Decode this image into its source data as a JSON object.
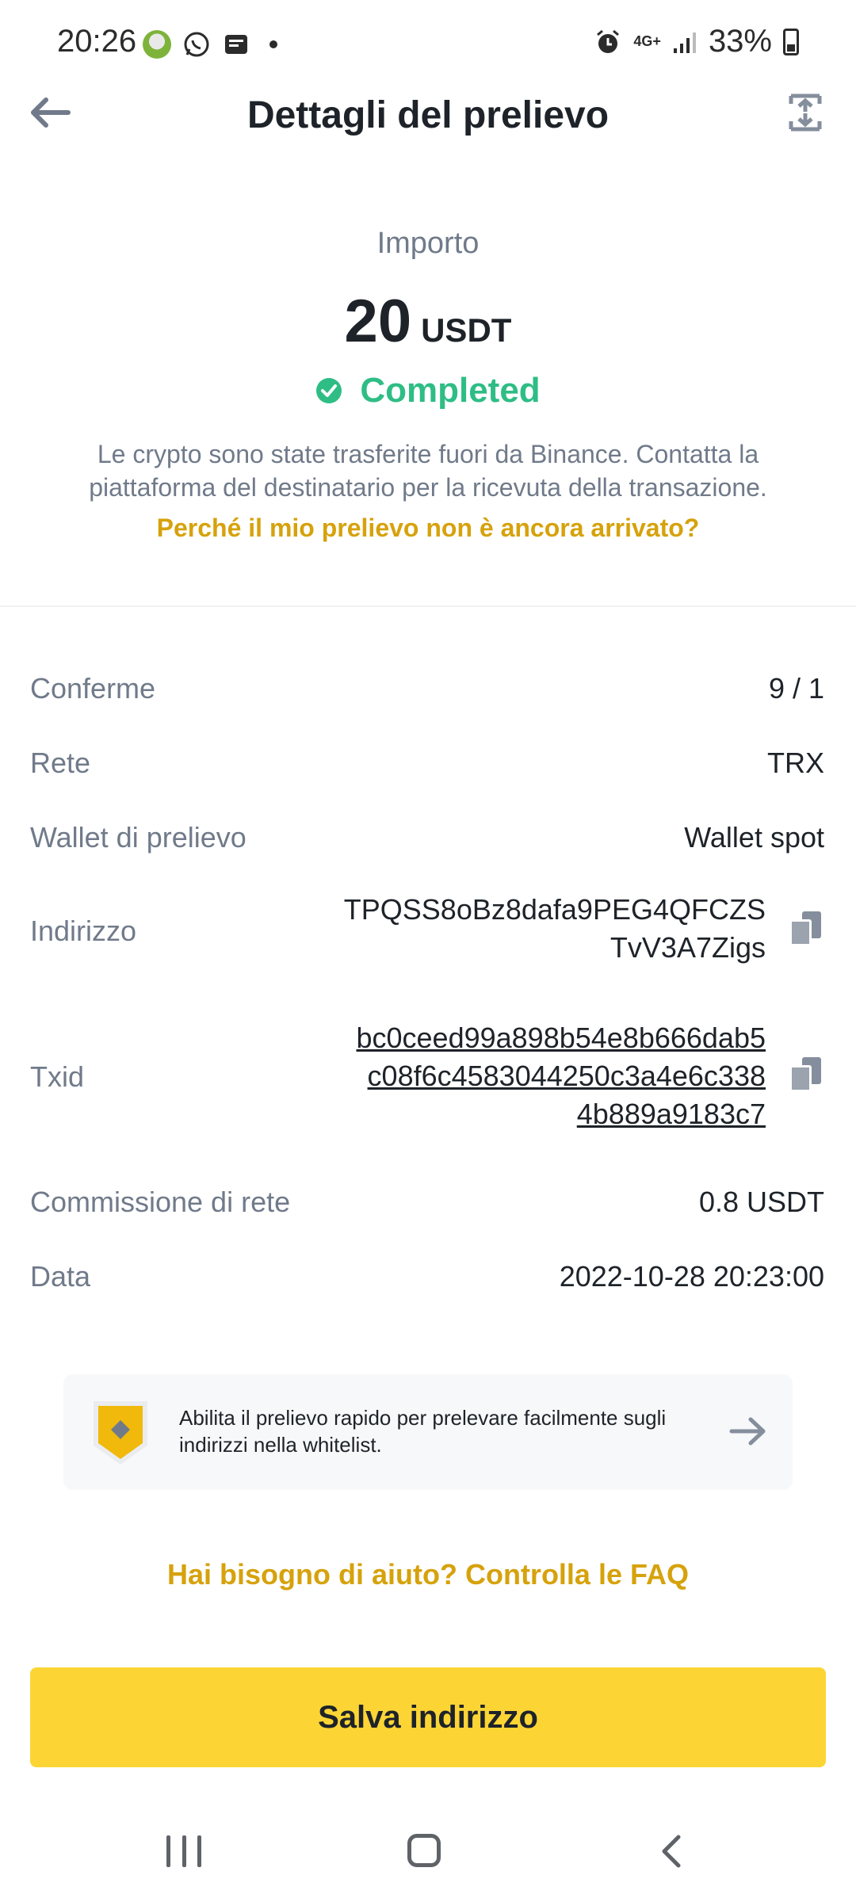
{
  "status_bar": {
    "time": "20:26",
    "network": "4G+",
    "battery": "33%",
    "icons": [
      "app-icon",
      "whatsapp-icon",
      "message-icon",
      "dot-icon",
      "alarm-icon",
      "signal-icon",
      "battery-icon"
    ]
  },
  "header": {
    "title": "Dettagli del prelievo",
    "back_icon": "arrow-left-icon",
    "share_icon": "share-icon"
  },
  "amount": {
    "label": "Importo",
    "value": "20",
    "unit": "USDT",
    "status": "Completed",
    "status_color": "#2ebd85",
    "info": "Le crypto sono state trasferite fuori da Binance. Contatta la piattaforma del destinatario per la ricevuta della transazione.",
    "help_link": "Perché il mio prelievo non è ancora arrivato?"
  },
  "details": {
    "confirmations": {
      "label": "Conferme",
      "value": "9 / 1"
    },
    "network": {
      "label": "Rete",
      "value": "TRX"
    },
    "wallet": {
      "label": "Wallet di prelievo",
      "value": "Wallet spot"
    },
    "address": {
      "label": "Indirizzo",
      "line1": "TPQSS8oBz8dafa9PEG4QFCZS",
      "line2": "TvV3A7Zigs"
    },
    "txid": {
      "label": "Txid",
      "line1": "bc0ceed99a898b54e8b666dab5",
      "line2": "c08f6c4583044250c3a4e6c338",
      "line3": "4b889a9183c7"
    },
    "fee": {
      "label": "Commissione di rete",
      "value": "0.8 USDT"
    },
    "date": {
      "label": "Data",
      "value": "2022-10-28 20:23:00"
    }
  },
  "banner": {
    "text": "Abilita il prelievo rapido per prelevare facilmente sugli indirizzi nella whitelist.",
    "icon": "shield-icon",
    "arrow": "arrow-right-icon"
  },
  "faq_link": "Hai bisogno di aiuto? Controlla le FAQ",
  "save_button": "Salva indirizzo",
  "colors": {
    "accent": "#fcd535",
    "link": "#d6a20c",
    "success": "#2ebd85"
  }
}
